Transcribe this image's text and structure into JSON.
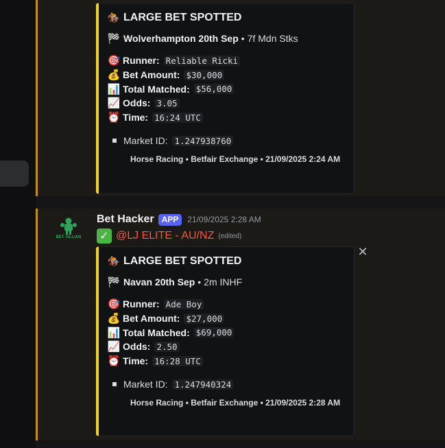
{
  "messages": [
    {
      "embed": {
        "title": "LARGE BET SPOTTED",
        "race": "Wolverhampton 20th Sep",
        "race_type": "7f Mdn Stks",
        "fields": [
          {
            "icon": "🎯",
            "label": "Runner:",
            "value": "Reliable Ricki"
          },
          {
            "icon": "💰",
            "label": "Bet Amount:",
            "value": "$30,000"
          },
          {
            "icon": "📊",
            "label": "Total Matched:",
            "value": "$56,000"
          },
          {
            "icon": "📈",
            "label": "Odds:",
            "value": "3.05"
          },
          {
            "icon": "⏰",
            "label": "Time:",
            "value": "16:24 UTC"
          }
        ],
        "market_label": "Market ID:",
        "market_id": "1.247938760",
        "footer": "Horse Racing • Betfair Exchange • 21/09/2025 2:24 AM"
      }
    },
    {
      "author": "Bet Hacker",
      "badge": "APP",
      "timestamp": "21/09/2025 2:28 AM",
      "avatar_text": "BET VILLIAN",
      "mention": "@LJ ELITE - AU/NZ",
      "edited": "(edited)",
      "embed": {
        "title": "LARGE BET SPOTTED",
        "race": "Navan 20th Sep",
        "race_type": "2m INHF",
        "fields": [
          {
            "icon": "🎯",
            "label": "Runner:",
            "value": "Ade Boy"
          },
          {
            "icon": "💰",
            "label": "Bet Amount:",
            "value": "$27,000"
          },
          {
            "icon": "📊",
            "label": "Total Matched:",
            "value": "$69,000"
          },
          {
            "icon": "📈",
            "label": "Odds:",
            "value": "2.50"
          },
          {
            "icon": "⏰",
            "label": "Time:",
            "value": "16:28 UTC"
          }
        ],
        "market_label": "Market ID:",
        "market_id": "1.247940324",
        "footer": "Horse Racing • Betfair Exchange • 21/09/2025 2:28 AM"
      }
    }
  ],
  "icons": {
    "title_icon": "🏇",
    "race_icon": "🏁",
    "close": "✕",
    "check": "✓"
  },
  "colors": {
    "embed_accent": "#f5d21e",
    "mention": "#f05a48",
    "app_badge": "#5865f2",
    "highlight_bar": "#c98a2a"
  }
}
